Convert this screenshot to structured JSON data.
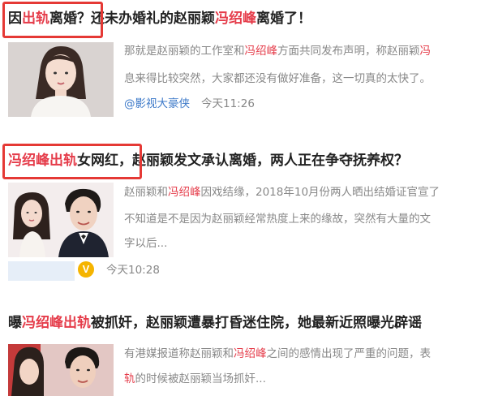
{
  "articles": [
    {
      "title": {
        "hl1": "出轨",
        "pre": "因",
        "mid": "离婚？还未办婚礼的赵丽颖",
        "hl2": "冯绍峰",
        "post": "离婚了！"
      },
      "snippet": {
        "line1_a": "那就是赵丽颖的工作室和",
        "line1_hl": "冯绍峰",
        "line1_b": "方面共同发布声明，称赵丽颖",
        "line1_c": "冯",
        "line2": "息来得比较突然，大家都还没有做好准备，这一切真的太快了。"
      },
      "source": "@影视大豪侠",
      "time": "今天11:26"
    },
    {
      "title": {
        "hl1": "冯绍峰出轨",
        "post1": "女网红",
        "post2": "，赵丽颖发文承认离婚，两人正在争夺抚养权？"
      },
      "snippet": {
        "line1_a": "赵丽颖和",
        "line1_hl": "冯绍峰",
        "line1_b": "因戏结缘，2018年10月份两人晒出结婚证官宣了",
        "line2": "不知道是不是因为赵丽颖经常热度上来的缘故，突然有大量的文",
        "line3": "字以后..."
      },
      "source_badge": "V",
      "time": "今天10:28"
    },
    {
      "title": {
        "pre": "曝",
        "hl1": "冯绍峰出轨",
        "post": "被抓奸，赵丽颖遭暴打昏迷住院，她最新近照曝光辟谣"
      },
      "snippet": {
        "line1_a": "有港媒报道称赵丽颖和",
        "line1_hl": "冯绍峰",
        "line1_b": "之间的感情出现了严重的问题，表",
        "line2_hl": "轨",
        "line2_b": "的时候被赵丽颖当场抓奸..."
      }
    }
  ],
  "colors": {
    "highlight": "#e53c4a",
    "box": "#e53935",
    "source": "#3b78c8",
    "meta": "#888888"
  }
}
